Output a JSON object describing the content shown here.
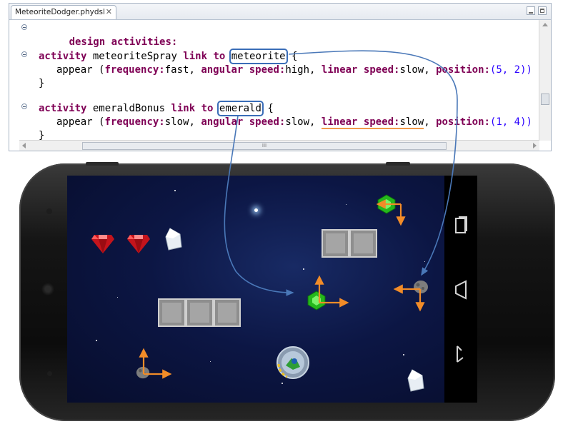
{
  "editor": {
    "tab_label": "MeteoriteDodger.phydsl",
    "close_glyph": "✕",
    "scroll_glyph": "III",
    "lines": {
      "l1": {
        "kw1": "design activities:"
      },
      "l2": {
        "kw1": "activity",
        "name": " meteoriteSpray ",
        "kw2": "link to",
        "sp": " ",
        "target": "meteorite",
        "brace": " {"
      },
      "l3": {
        "call": "appear (",
        "k1": "frequency:",
        "v1": "fast",
        "s1": ", ",
        "k2": "angular speed:",
        "v2": "high",
        "s2": ", ",
        "k3": "linear speed:",
        "v3": "slow",
        "s3": ", ",
        "k4": "position:",
        "v4": "(5, 2))"
      },
      "l4": {
        "text": "}"
      },
      "l5": {
        "kw1": "activity",
        "name": " emeraldBonus ",
        "kw2": "link to",
        "sp": " ",
        "target": "emerald",
        "brace": " {"
      },
      "l6": {
        "call": "appear (",
        "k1": "frequency:",
        "v1": "slow",
        "s1": ", ",
        "k2": "angular speed:",
        "v2": "slow",
        "s2": ", ",
        "k3": "linear speed:",
        "v3": "slow",
        "s3": ", ",
        "k4": "position:",
        "v4": "(1, 4))"
      },
      "l7": {
        "text": "}"
      }
    }
  },
  "phone": {
    "nav_buttons": [
      "recent-apps-icon",
      "back-icon",
      "home-icon"
    ]
  },
  "game": {
    "objects": [
      "ruby-gem",
      "ruby-gem",
      "diamond-gem",
      "stone-block-row",
      "stone-block-row",
      "emerald-gem",
      "meteorite",
      "player-ship",
      "diamond-gem"
    ]
  },
  "colors": {
    "keyword": "#7f0055",
    "value": "#2a00ff",
    "highlight_box": "#3a6db8",
    "link_arrow": "#4a78b8",
    "motion_arrow": "#f28c28",
    "warning_underline": "#f2994a"
  }
}
